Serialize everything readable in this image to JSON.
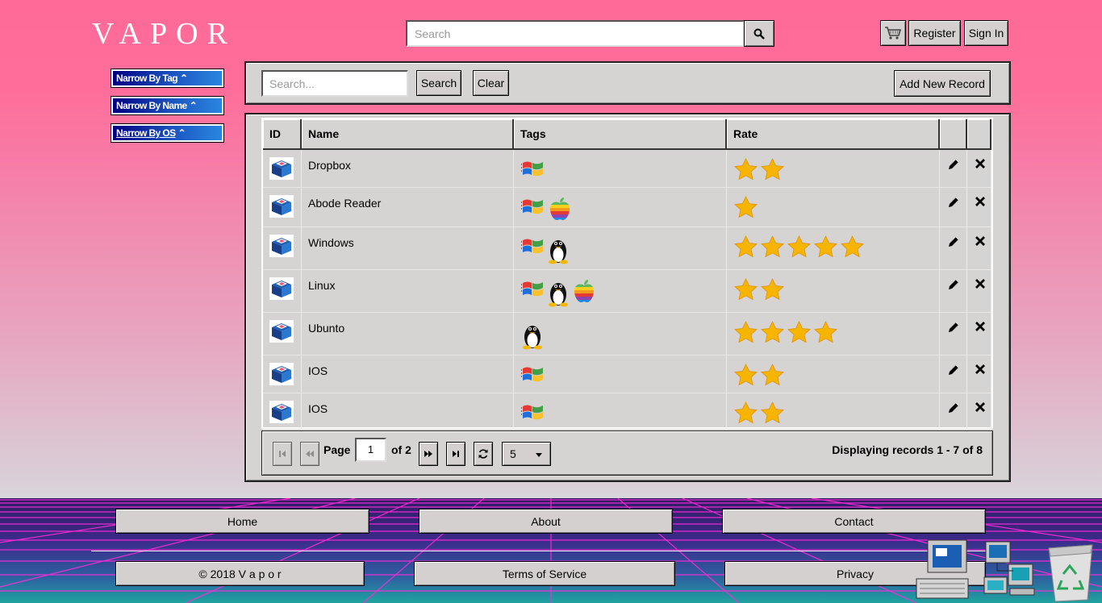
{
  "header": {
    "logo": "VAPOR",
    "search_placeholder": "Search",
    "register_label": "Register",
    "signin_label": "Sign In"
  },
  "sidebar": {
    "filters": [
      {
        "label": "Narrow By Tag"
      },
      {
        "label": "Narrow By Name"
      },
      {
        "label": "Narrow By OS"
      }
    ]
  },
  "toolbar": {
    "search_placeholder": "Search...",
    "search_label": "Search",
    "clear_label": "Clear",
    "add_label": "Add New Record"
  },
  "table": {
    "columns": [
      "ID",
      "Name",
      "Tags",
      "Rate"
    ],
    "rows": [
      {
        "name": "Dropbox",
        "tags": [
          "windows"
        ],
        "rating": 2
      },
      {
        "name": "Abode Reader",
        "tags": [
          "windows",
          "apple"
        ],
        "rating": 1
      },
      {
        "name": "Windows",
        "tags": [
          "windows",
          "linux"
        ],
        "rating": 5
      },
      {
        "name": "Linux",
        "tags": [
          "windows",
          "linux",
          "apple"
        ],
        "rating": 2
      },
      {
        "name": "Ubunto",
        "tags": [
          "linux"
        ],
        "rating": 4
      },
      {
        "name": "IOS",
        "tags": [
          "windows"
        ],
        "rating": 2
      },
      {
        "name": "IOS",
        "tags": [
          "windows"
        ],
        "rating": 2
      }
    ]
  },
  "pager": {
    "page_label": "Page",
    "current_page": "1",
    "of_label": "of 2",
    "page_size": "5",
    "display_info": "Displaying records 1 - 7 of 8"
  },
  "footer": {
    "links": [
      "Home",
      "About",
      "Contact"
    ],
    "copyright": "© 2018 V a p o r",
    "terms": "Terms of Service",
    "privacy": "Privacy"
  },
  "colors": {
    "accent_pink": "#ff6a98",
    "panel_gray": "#d6d3d3",
    "star": "#f7b500",
    "title_blue": "#000080"
  },
  "icons": [
    "search-icon",
    "cart-icon",
    "caret-up-icon",
    "app-box-icon",
    "windows-icon",
    "apple-icon",
    "linux-icon",
    "star-icon",
    "edit-icon",
    "delete-icon",
    "first-page-icon",
    "prev-page-icon",
    "next-page-icon",
    "last-page-icon",
    "refresh-icon",
    "computer-icon",
    "network-icon",
    "recycle-bin-icon"
  ]
}
